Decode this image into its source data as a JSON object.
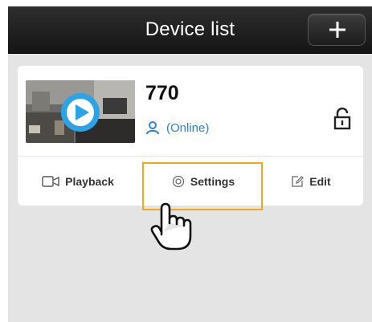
{
  "navbar": {
    "title": "Device list",
    "add_icon": "plus-icon"
  },
  "device": {
    "name": "770",
    "status": "(Online)",
    "status_icon": "user-icon",
    "lock_icon": "unlocked-padlock-icon",
    "thumbnail_overlay_icon": "play-icon"
  },
  "actions": {
    "playback_label": "Playback",
    "playback_icon": "video-camera-icon",
    "settings_label": "Settings",
    "settings_icon": "gear-icon",
    "edit_label": "Edit",
    "edit_icon": "edit-pencil-icon"
  },
  "colors": {
    "navbar": "#1f1f1f",
    "background": "#e4e4e4",
    "status_blue": "#2f80e0",
    "highlight_orange": "#f2a81e"
  }
}
